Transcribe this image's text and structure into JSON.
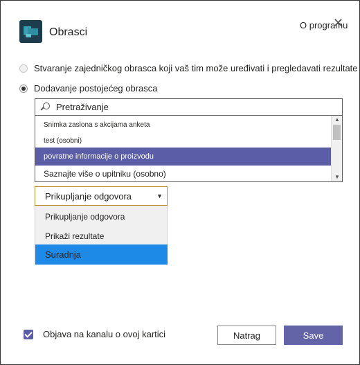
{
  "app": {
    "title": "Obrasci",
    "icon": "forms-app-icon",
    "about_label": "O programu",
    "close_icon": "close-icon"
  },
  "options": {
    "create_shared_form": "Stvaranje zajedničkog obrasca koji vaš tim može uređivati i pregledavati rezultate",
    "add_existing_form": "Dodavanje postojećeg obrasca",
    "selected": "add_existing_form"
  },
  "search": {
    "placeholder": "Pretraživanje",
    "value": ""
  },
  "forms": [
    {
      "label": "Snimka zaslona s akcijama anketa",
      "selected": false
    },
    {
      "label": "test (osobni)",
      "selected": false
    },
    {
      "label": "povratne informacije o proizvodu",
      "selected": true
    },
    {
      "label": "Saznajte više o upitniku (osobno)",
      "selected": false
    }
  ],
  "mode_select": {
    "selected": "Prikupljanje odgovora",
    "options": [
      "Prikupljanje odgovora",
      "Prikaži rezultate",
      "Suradnja"
    ],
    "highlighted": "Suradnja"
  },
  "footer": {
    "post_to_channel_label": "Objava na kanalu o ovoj kartici",
    "post_to_channel_checked": true,
    "back_label": "Natrag",
    "save_label": "Save"
  },
  "colors": {
    "accent": "#6264a7",
    "selected_row": "#5b5ea6",
    "dropdown_highlight": "#1e8ae8",
    "app_icon_bg": "#1e3d4c"
  }
}
